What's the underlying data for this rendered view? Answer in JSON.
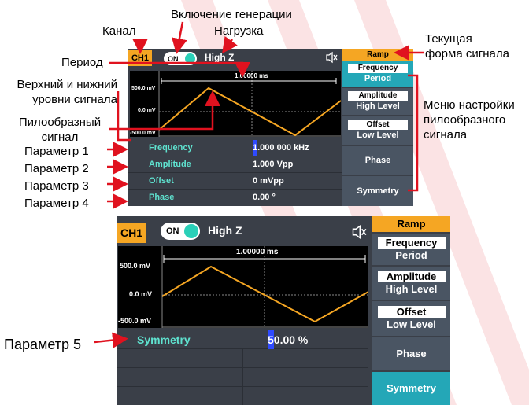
{
  "annotations": {
    "channel": "Канал",
    "output_enable": "Включение генерации",
    "load": "Нагрузка",
    "period": "Период",
    "levels": "Верхний и нижний\nуровни сигнала",
    "ramp_signal": "Пилообразный\nсигнал",
    "current_waveform": "Текущая\nформа сигнала",
    "ramp_menu": "Меню настройки\nпилообразного\nсигнала",
    "param1": "Параметр 1",
    "param2": "Параметр 2",
    "param3": "Параметр 3",
    "param4": "Параметр 4",
    "param5": "Параметр 5"
  },
  "screen1": {
    "channel": "CH1",
    "output": "ON",
    "load": "High Z",
    "period_readout": "1.00000 ms",
    "y_labels": [
      "500.0 mV",
      "0.0 mV",
      "-500.0 mV"
    ],
    "params": [
      {
        "name": "Frequency",
        "value_cursor": "1",
        "value": ".000 000 kHz"
      },
      {
        "name": "Amplitude",
        "value_cursor": "",
        "value": "1.000 Vpp"
      },
      {
        "name": "Offset",
        "value_cursor": "",
        "value": "0 mVpp"
      },
      {
        "name": "Phase",
        "value_cursor": "",
        "value": "0.00 °"
      }
    ],
    "menu": {
      "title": "Ramp",
      "items": [
        {
          "top": "Frequency",
          "bottom": "Period"
        },
        {
          "top": "Amplitude",
          "bottom": "High Level"
        },
        {
          "top": "Offset",
          "bottom": "Low Level"
        },
        {
          "top": "",
          "bottom": "Phase"
        },
        {
          "top": "",
          "bottom": "Symmetry"
        }
      ]
    }
  },
  "screen2": {
    "channel": "CH1",
    "output": "ON",
    "load": "High Z",
    "period_readout": "1.00000 ms",
    "y_labels": [
      "500.0 mV",
      "0.0 mV",
      "-500.0 mV"
    ],
    "params": [
      {
        "name": "Symmetry",
        "value_cursor": "5",
        "value": "0.00 %"
      }
    ],
    "menu": {
      "title": "Ramp",
      "items": [
        {
          "top": "Frequency",
          "bottom": "Period"
        },
        {
          "top": "Amplitude",
          "bottom": "High Level"
        },
        {
          "top": "Offset",
          "bottom": "Low Level"
        },
        {
          "top": "",
          "bottom": "Phase"
        },
        {
          "top": "",
          "bottom": "Symmetry"
        }
      ]
    }
  },
  "colors": {
    "accent": "#f5a623",
    "teal": "#2ad0b8",
    "param_name": "#5fe3d0",
    "active_menu": "#24a7b7",
    "arrow": "#e0121f"
  },
  "icons": [
    "mute-speaker-icon",
    "toggle-switch-icon"
  ]
}
